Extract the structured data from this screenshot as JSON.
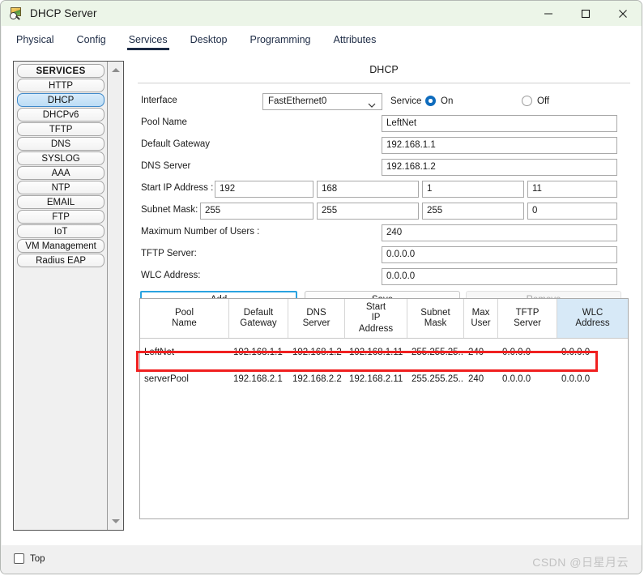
{
  "window": {
    "title": "DHCP Server",
    "icon": "picture-magnifier-icon",
    "minimize": "–",
    "maximize": "□",
    "close": "✕",
    "titlebar_color": "#ecf5e8"
  },
  "tabs": [
    {
      "label": "Physical",
      "active": false
    },
    {
      "label": "Config",
      "active": false
    },
    {
      "label": "Services",
      "active": true
    },
    {
      "label": "Desktop",
      "active": false
    },
    {
      "label": "Programming",
      "active": false
    },
    {
      "label": "Attributes",
      "active": false
    }
  ],
  "sidebar": {
    "header": "SERVICES",
    "selected": "DHCP",
    "items": [
      {
        "label": "HTTP"
      },
      {
        "label": "DHCP"
      },
      {
        "label": "DHCPv6"
      },
      {
        "label": "TFTP"
      },
      {
        "label": "DNS"
      },
      {
        "label": "SYSLOG"
      },
      {
        "label": "AAA"
      },
      {
        "label": "NTP"
      },
      {
        "label": "EMAIL"
      },
      {
        "label": "FTP"
      },
      {
        "label": "IoT"
      },
      {
        "label": "VM Management"
      },
      {
        "label": "Radius EAP"
      }
    ]
  },
  "panel": {
    "title": "DHCP",
    "interface_label": "Interface",
    "interface_value": "FastEthernet0",
    "service_label": "Service",
    "service_on": "On",
    "service_off": "Off",
    "service_state": "On",
    "pool_name_label": "Pool Name",
    "pool_name_value": "LeftNet",
    "default_gateway_label": "Default Gateway",
    "default_gateway_value": "192.168.1.1",
    "dns_server_label": "DNS Server",
    "dns_server_value": "192.168.1.2",
    "start_ip_label": "Start IP Address :",
    "start_ip_octets": [
      "192",
      "168",
      "1",
      "11"
    ],
    "subnet_mask_label": "Subnet Mask:",
    "subnet_mask_octets": [
      "255",
      "255",
      "255",
      "0"
    ],
    "max_users_label": "Maximum Number of Users :",
    "max_users_value": "240",
    "tftp_label": "TFTP Server:",
    "tftp_value": "0.0.0.0",
    "wlc_label": "WLC Address:",
    "wlc_value": "0.0.0.0",
    "add_button": "Add",
    "save_button": "Save",
    "remove_button": "Remove",
    "accent_focus": "#2aa3e0",
    "radio_accent": "#0f6cbd"
  },
  "table": {
    "columns": [
      "Pool\nName",
      "Default\nGateway",
      "DNS\nServer",
      "Start\nIP\nAddress",
      "Subnet\nMask",
      "Max\nUser",
      "TFTP\nServer",
      "WLC\nAddress"
    ],
    "highlighted_column": "WLC Address",
    "highlight_color": "#d7e9f7",
    "rows": [
      {
        "pool_name": "LeftNet",
        "default_gateway": "192.168.1.1",
        "dns_server": "192.168.1.2",
        "start_ip": "192.168.1.11",
        "subnet_mask": "255.255.25...",
        "max_user": "240",
        "tftp_server": "0.0.0.0",
        "wlc_address": "0.0.0.0",
        "annotated": true
      },
      {
        "pool_name": "serverPool",
        "default_gateway": "192.168.2.1",
        "dns_server": "192.168.2.2",
        "start_ip": "192.168.2.11",
        "subnet_mask": "255.255.25...",
        "max_user": "240",
        "tftp_server": "0.0.0.0",
        "wlc_address": "0.0.0.0",
        "annotated": false
      }
    ],
    "annotation_color": "#f02020"
  },
  "footer": {
    "top_checkbox_label": "Top",
    "top_checked": false
  },
  "watermark": "CSDN @日星月云"
}
